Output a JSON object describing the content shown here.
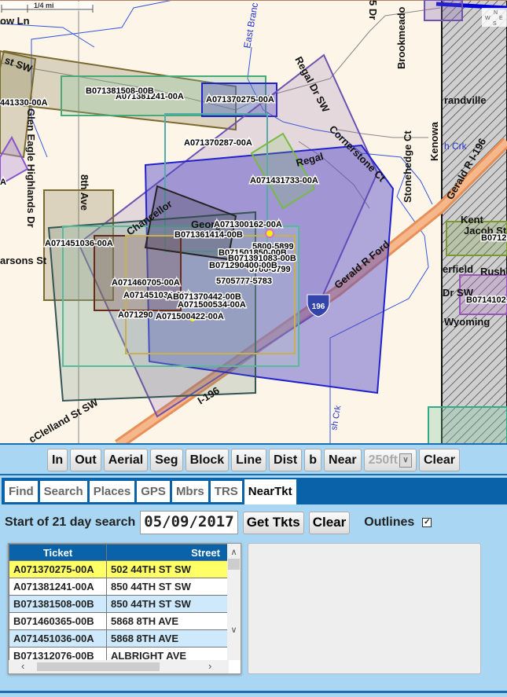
{
  "map": {
    "scale_label": "1/4 mi",
    "compass": [
      "N",
      "W",
      "E",
      "S"
    ],
    "streets": [
      "ow Ln",
      "st SW",
      "Glen Eagle Highlands Dr",
      "8th Ave",
      "Chancellor",
      "Regal Dr SW",
      "Cornerstone Ct",
      "Stonehedge Ct",
      "Kenowa",
      "Brookmeado",
      "5 Dr",
      "Regal",
      "Gerald R Ford",
      "I-196",
      "Gerald R I-196",
      "Kent",
      "randville",
      "Wyoming",
      "erfield",
      "Rush",
      "Jacob St",
      "Dr SW",
      "h Crk",
      "sh Crk",
      "cClelland St SW",
      "East Branc",
      "arsons St",
      "Georg"
    ],
    "shield": "196",
    "ticket_labels": [
      "441330-00A",
      "B071381508-00B",
      "A071381241-00A",
      "A071370275-00A",
      "A071370287-00A",
      "A071431733-00A",
      "A071300162-00A",
      "B071361414-00B",
      "A071451036-00A",
      "5800-5899",
      "B071501850-00B",
      "B071391083-00B",
      "B071290400-00B",
      "5700-5799",
      "5705777-5783",
      "A071460705-00A",
      "A071451036-00A",
      "AB071370442-00B",
      "A071500534-00A",
      "A071290",
      "A071500422-00A",
      "B0712",
      "B0714102",
      "A"
    ]
  },
  "toolbar": {
    "buttons": [
      "In",
      "Out",
      "Aerial",
      "Seg",
      "Block",
      "Line",
      "Dist",
      "b",
      "Near"
    ],
    "distance_select": "250ft",
    "clear": "Clear"
  },
  "tabs": [
    {
      "label": "Find"
    },
    {
      "label": "Search"
    },
    {
      "label": "Places"
    },
    {
      "label": "GPS"
    },
    {
      "label": "Mbrs"
    },
    {
      "label": "TRS"
    },
    {
      "label": "NearTkt",
      "active": true
    }
  ],
  "search": {
    "label": "Start of 21 day search",
    "date": "05/09/2017",
    "get_tickets": "Get Tkts",
    "clear": "Clear",
    "outlines_label": "Outlines",
    "outlines_checked": true
  },
  "table": {
    "columns": [
      "Ticket",
      "Street"
    ],
    "rows": [
      {
        "ticket": "A071370275-00A",
        "street": "502 44TH ST SW",
        "selected": true
      },
      {
        "ticket": "A071381241-00A",
        "street": "850 44TH ST SW"
      },
      {
        "ticket": "B071381508-00B",
        "street": "850 44TH ST SW"
      },
      {
        "ticket": "B071460365-00B",
        "street": "5868 8TH AVE"
      },
      {
        "ticket": "A071451036-00A",
        "street": "5868 8TH AVE"
      },
      {
        "ticket": "B071312076-00B",
        "street": "ALBRIGHT AVE"
      }
    ]
  },
  "colors": {
    "accent": "#0a63a8",
    "background": "#a8d6f3",
    "selected_row": "#ffff66",
    "alt_row": "#cde9fb",
    "map_bg": "#fdf5e8",
    "highway": "#f0a060"
  }
}
